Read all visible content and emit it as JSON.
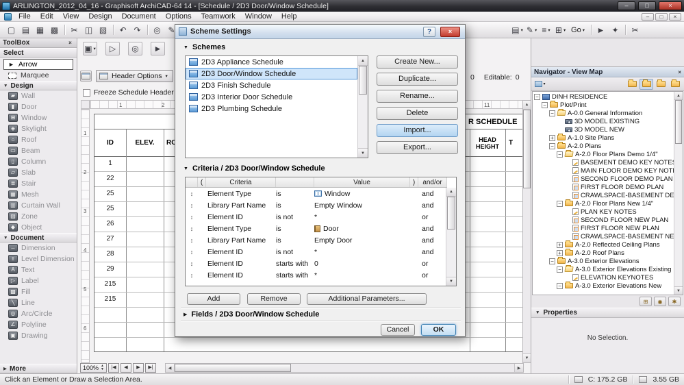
{
  "window": {
    "title": "ARLINGTON_2012_04_16 - Graphisoft ArchiCAD-64 14 - [Schedule / 2D3 Door/Window Schedule]"
  },
  "icons": {
    "minimize": "–",
    "maximize": "□",
    "close": "×",
    "help": "?",
    "dropdown": "▾",
    "tri_open": "▼",
    "tri_closed": "▶",
    "reorder": "↕",
    "up": "▲",
    "down": "▼",
    "left": "◀",
    "right": "▶"
  },
  "menu": {
    "items": [
      "File",
      "Edit",
      "View",
      "Design",
      "Document",
      "Options",
      "Teamwork",
      "Window",
      "Help"
    ]
  },
  "toolbar": {
    "left": [
      {
        "type": "icon",
        "name": "new-icon",
        "glyph": "▢",
        "inter": "true"
      },
      {
        "type": "icon",
        "name": "open-icon",
        "glyph": "▤",
        "inter": "true"
      },
      {
        "type": "icon",
        "name": "save-icon",
        "glyph": "▦",
        "inter": "true"
      },
      {
        "type": "icon",
        "name": "print-icon",
        "glyph": "▩",
        "inter": "true"
      },
      {
        "type": "sep",
        "name": "separator",
        "glyph": "",
        "inter": "false"
      },
      {
        "type": "icon",
        "name": "cut-icon",
        "glyph": "✂",
        "inter": "true"
      },
      {
        "type": "icon",
        "name": "copy-icon",
        "glyph": "◫",
        "inter": "true"
      },
      {
        "type": "icon",
        "name": "paste-icon",
        "glyph": "▧",
        "inter": "true"
      },
      {
        "type": "sep",
        "name": "separator",
        "glyph": "",
        "inter": "false"
      },
      {
        "type": "icon",
        "name": "undo-icon",
        "glyph": "↶",
        "inter": "true"
      },
      {
        "type": "icon",
        "name": "redo-icon",
        "glyph": "↷",
        "inter": "true"
      },
      {
        "type": "sep",
        "name": "separator",
        "glyph": "",
        "inter": "false"
      },
      {
        "type": "icon",
        "name": "zoom-icon",
        "glyph": "◎",
        "inter": "true"
      },
      {
        "type": "icon",
        "name": "pen-icon",
        "glyph": "✎",
        "inter": "true"
      },
      {
        "type": "sep",
        "name": "separator",
        "glyph": "",
        "inter": "false"
      },
      {
        "type": "icon",
        "name": "options-icon",
        "glyph": "≡",
        "inter": "true"
      }
    ],
    "right": [
      {
        "type": "dd",
        "name": "layers-icon",
        "glyph": "▤",
        "inter": "true"
      },
      {
        "type": "dd",
        "name": "pen-set-icon",
        "glyph": "✎",
        "inter": "true"
      },
      {
        "type": "dd",
        "name": "line-type-icon",
        "glyph": "≡",
        "inter": "true"
      },
      {
        "type": "dd",
        "name": "display-options-icon",
        "glyph": "⊞",
        "inter": "true"
      },
      {
        "type": "ddtext",
        "name": "go-menu",
        "glyph": "Go",
        "inter": "true"
      },
      {
        "type": "sep",
        "name": "separator",
        "glyph": "",
        "inter": "false"
      },
      {
        "type": "icon",
        "name": "arrow-tool-icon",
        "glyph": "►",
        "inter": "true"
      },
      {
        "type": "icon",
        "name": "walk-tool-icon",
        "glyph": "✦",
        "inter": "true"
      },
      {
        "type": "sep",
        "name": "separator",
        "glyph": "",
        "inter": "false"
      },
      {
        "type": "icon",
        "name": "section-tool-icon",
        "glyph": "✂",
        "inter": "true"
      }
    ]
  },
  "toolbox": {
    "title": "ToolBox",
    "select_label": "Select",
    "arrow": {
      "label": "Arrow",
      "glyph": "►"
    },
    "marquee": {
      "label": "Marquee"
    },
    "design": {
      "label": "Design",
      "items": [
        {
          "label": "Wall",
          "icon": "wall-icon",
          "glyph": "▰"
        },
        {
          "label": "Door",
          "icon": "door-icon",
          "glyph": "▮"
        },
        {
          "label": "Window",
          "icon": "window-icon",
          "glyph": "⊞"
        },
        {
          "label": "Skylight",
          "icon": "skylight-icon",
          "glyph": "◈"
        },
        {
          "label": "Roof",
          "icon": "roof-icon",
          "glyph": "⌂"
        },
        {
          "label": "Beam",
          "icon": "beam-icon",
          "glyph": "▭"
        },
        {
          "label": "Column",
          "icon": "column-icon",
          "glyph": "▯"
        },
        {
          "label": "Slab",
          "icon": "slab-icon",
          "glyph": "▱"
        },
        {
          "label": "Stair",
          "icon": "stair-icon",
          "glyph": "≣"
        },
        {
          "label": "Mesh",
          "icon": "mesh-icon",
          "glyph": "▦"
        },
        {
          "label": "Curtain Wall",
          "icon": "curtain-wall-icon",
          "glyph": "▥"
        },
        {
          "label": "Zone",
          "icon": "zone-icon",
          "glyph": "▨"
        },
        {
          "label": "Object",
          "icon": "object-icon",
          "glyph": "◆"
        }
      ]
    },
    "document": {
      "label": "Document",
      "items": [
        {
          "label": "Dimension",
          "icon": "dimension-icon",
          "glyph": "↔"
        },
        {
          "label": "Level Dimension",
          "icon": "level-dimension-icon",
          "glyph": "±"
        },
        {
          "label": "Text",
          "icon": "text-icon",
          "glyph": "A"
        },
        {
          "label": "Label",
          "icon": "label-icon",
          "glyph": "▷"
        },
        {
          "label": "Fill",
          "icon": "fill-icon",
          "glyph": "▩"
        },
        {
          "label": "Line",
          "icon": "line-icon",
          "glyph": "╲"
        },
        {
          "label": "Arc/Circle",
          "icon": "arc-circle-icon",
          "glyph": "◎"
        },
        {
          "label": "Polyline",
          "icon": "polyline-icon",
          "glyph": "∠"
        },
        {
          "label": "Drawing",
          "icon": "drawing-icon",
          "glyph": "▣"
        }
      ]
    },
    "more_label": "More"
  },
  "schedule": {
    "tools": [
      {
        "type": "dd",
        "name": "pet-palette-icon",
        "glyph": "▣",
        "inter": "true"
      },
      {
        "type": "icon",
        "name": "tool-arrow-icon",
        "glyph": "▷",
        "inter": "true"
      },
      {
        "type": "icon",
        "name": "tool-circle-icon",
        "glyph": "◎",
        "inter": "true"
      },
      {
        "type": "icon",
        "name": "tool-cursor-icon",
        "glyph": "►",
        "inter": "true"
      }
    ],
    "header_options_label": "Header Options",
    "merge_icon_glyph": "⊟",
    "freeze_label": "Freeze Schedule Header",
    "freeze_checked": false,
    "count_value": "0",
    "editable_label": "Editable:",
    "editable_value": "0",
    "title_fragment": "R SCHEDULE",
    "columns": [
      "ID",
      "ELEV.",
      "RO"
    ],
    "right_columns": [
      "HEAD HEIGHT",
      "T"
    ],
    "rows": [
      "1",
      "22",
      "25",
      "25",
      "26",
      "27",
      "28",
      "29",
      "215",
      "215",
      "",
      "",
      ""
    ],
    "zoom": "100%",
    "nav_buttons": [
      "|◀",
      "◀",
      "▶",
      "▶|"
    ],
    "h_ruler": [
      {
        "label": "1",
        "style": "left:42px"
      },
      {
        "label": "2",
        "style": "left:104px"
      },
      {
        "label": "11",
        "style": "left:575px"
      }
    ],
    "v_ruler": [
      {
        "label": "1",
        "style": "top:30px"
      },
      {
        "label": "2",
        "style": "top:87px"
      },
      {
        "label": "3",
        "style": "top:144px"
      },
      {
        "label": "4",
        "style": "top:201px"
      },
      {
        "label": "5",
        "style": "top:258px"
      },
      {
        "label": "6",
        "style": "top:315px"
      }
    ]
  },
  "dialog": {
    "title": "Scheme Settings",
    "schemes_label": "Schemes",
    "schemes": [
      {
        "label": "2D3 Appliance Schedule",
        "selected": false
      },
      {
        "label": "2D3 Door/Window Schedule",
        "selected": true
      },
      {
        "label": "2D3 Finish Schedule",
        "selected": false
      },
      {
        "label": "2D3 Interior Door Schedule",
        "selected": false
      },
      {
        "label": "2D3 Plumbing Schedule",
        "selected": false
      }
    ],
    "buttons": [
      {
        "label": "Create New...",
        "name": "create-new-button",
        "highlight": false
      },
      {
        "label": "Duplicate...",
        "name": "duplicate-button",
        "highlight": false
      },
      {
        "label": "Rename...",
        "name": "rename-button",
        "highlight": false
      },
      {
        "label": "Delete",
        "name": "delete-button",
        "highlight": false
      },
      {
        "label": "Import...",
        "name": "import-button",
        "highlight": true
      },
      {
        "label": "Export...",
        "name": "export-button",
        "highlight": false
      }
    ],
    "criteria_label": "Criteria / 2D3 Door/Window Schedule",
    "criteria_headers": {
      "open_paren": "(",
      "criteria": "Criteria",
      "op": "",
      "value": "Value",
      "close_paren": ")",
      "andor": "and/or"
    },
    "criteria_rows": [
      {
        "criteria": "Element Type",
        "op": "is",
        "value": "Window",
        "icon": "window",
        "icon_name": "window-icon",
        "andor": "and"
      },
      {
        "criteria": "Library Part Name",
        "op": "is",
        "value": "Empty Window",
        "icon": "none",
        "icon_name": "no-icon",
        "andor": "and"
      },
      {
        "criteria": "Element ID",
        "op": "is not",
        "value": "*",
        "icon": "none",
        "icon_name": "no-icon",
        "andor": "or"
      },
      {
        "criteria": "Element Type",
        "op": "is",
        "value": "Door",
        "icon": "door",
        "icon_name": "door-icon",
        "andor": "and"
      },
      {
        "criteria": "Library Part Name",
        "op": "is",
        "value": "Empty Door",
        "icon": "none",
        "icon_name": "no-icon",
        "andor": "and"
      },
      {
        "criteria": "Element ID",
        "op": "is not",
        "value": "*",
        "icon": "none",
        "icon_name": "no-icon",
        "andor": "and"
      },
      {
        "criteria": "Element ID",
        "op": "starts with",
        "value": "0",
        "icon": "none",
        "icon_name": "no-icon",
        "andor": "or"
      },
      {
        "criteria": "Element ID",
        "op": "starts with",
        "value": "*",
        "icon": "none",
        "icon_name": "no-icon",
        "andor": "or"
      }
    ],
    "add_label": "Add",
    "remove_label": "Remove",
    "additional_label": "Additional Parameters...",
    "fields_label": "Fields / 2D3 Door/Window Schedule",
    "cancel_label": "Cancel",
    "ok_label": "OK"
  },
  "navigator": {
    "title": "Navigator - View Map",
    "right_icons": [
      {
        "name": "project-map-icon",
        "active": false
      },
      {
        "name": "view-map-icon",
        "active": true
      },
      {
        "name": "layout-book-icon",
        "active": false
      },
      {
        "name": "publisher-sets-icon",
        "active": false
      }
    ],
    "bottom_icons": [
      {
        "name": "new-folder-icon",
        "glyph": "⊞"
      },
      {
        "name": "save-view-icon",
        "glyph": "◉"
      },
      {
        "name": "settings-icon",
        "glyph": "✱"
      }
    ],
    "tree": [
      {
        "label": "DINH RESIDENCE",
        "depth": 0,
        "icon": "project",
        "icon_name": "project-icon",
        "expand": "minus"
      },
      {
        "label": "Plot/Print",
        "depth": 1,
        "icon": "folder",
        "icon_name": "folder-icon",
        "expand": "minus"
      },
      {
        "label": "A-0.0 General Information",
        "depth": 2,
        "icon": "folder-open",
        "icon_name": "open-folder-icon",
        "expand": "minus"
      },
      {
        "label": "3D MODEL EXISTING",
        "depth": 3,
        "icon": "camera",
        "icon_name": "camera-icon",
        "expand": "none"
      },
      {
        "label": "3D MODEL NEW",
        "depth": 3,
        "icon": "camera",
        "icon_name": "camera-icon",
        "expand": "none"
      },
      {
        "label": "A-1.0 Site Plans",
        "depth": 2,
        "icon": "folder",
        "icon_name": "folder-icon",
        "expand": "plus"
      },
      {
        "label": "A-2.0 Plans",
        "depth": 2,
        "icon": "folder",
        "icon_name": "folder-icon",
        "expand": "minus"
      },
      {
        "label": "A-2.0 Floor Plans Demo 1/4\"",
        "depth": 3,
        "icon": "folder-open",
        "icon_name": "open-folder-icon",
        "expand": "minus"
      },
      {
        "label": "BASEMENT DEMO KEY NOTES",
        "depth": 4,
        "icon": "note",
        "icon_name": "keynote-icon",
        "expand": "none"
      },
      {
        "label": "MAIN FLOOR DEMO KEY NOTES",
        "depth": 4,
        "icon": "note",
        "icon_name": "keynote-icon",
        "expand": "none"
      },
      {
        "label": "SECOND FLOOR DEMO PLAN",
        "depth": 4,
        "icon": "plan",
        "icon_name": "plan-icon",
        "expand": "none"
      },
      {
        "label": "FIRST FLOOR DEMO PLAN",
        "depth": 4,
        "icon": "plan",
        "icon_name": "plan-icon",
        "expand": "none"
      },
      {
        "label": "CRAWLSPACE-BASEMENT DEMO P...",
        "depth": 4,
        "icon": "plan",
        "icon_name": "plan-icon",
        "expand": "none"
      },
      {
        "label": "A-2.0 Floor Plans New 1/4\"",
        "depth": 3,
        "icon": "folder",
        "icon_name": "folder-icon",
        "expand": "minus"
      },
      {
        "label": "PLAN KEY NOTES",
        "depth": 4,
        "icon": "note",
        "icon_name": "keynote-icon",
        "expand": "none"
      },
      {
        "label": "SECOND FLOOR NEW PLAN",
        "depth": 4,
        "icon": "plan",
        "icon_name": "plan-icon",
        "expand": "none"
      },
      {
        "label": "FIRST FLOOR NEW PLAN",
        "depth": 4,
        "icon": "plan",
        "icon_name": "plan-icon",
        "expand": "none"
      },
      {
        "label": "CRAWLSPACE-BASEMENT NEW PL...",
        "depth": 4,
        "icon": "plan",
        "icon_name": "plan-icon",
        "expand": "none"
      },
      {
        "label": "A-2.0 Reflected Ceiling Plans",
        "depth": 3,
        "icon": "folder",
        "icon_name": "folder-icon",
        "expand": "plus"
      },
      {
        "label": "A-2.0 Roof Plans",
        "depth": 3,
        "icon": "folder",
        "icon_name": "folder-icon",
        "expand": "plus"
      },
      {
        "label": "A-3.0 Exterior Elevations",
        "depth": 2,
        "icon": "folder",
        "icon_name": "folder-icon",
        "expand": "minus"
      },
      {
        "label": "A-3.0 Exterior Elevations Existing",
        "depth": 3,
        "icon": "folder-open",
        "icon_name": "open-folder-icon",
        "expand": "minus"
      },
      {
        "label": "ELEVATION KEYNOTES",
        "depth": 4,
        "icon": "note",
        "icon_name": "keynote-icon",
        "expand": "none"
      },
      {
        "label": "A-3.0 Exterior Elevations New",
        "depth": 3,
        "icon": "folder",
        "icon_name": "folder-icon",
        "expand": "minus"
      }
    ],
    "properties_label": "Properties",
    "no_selection": "No Selection."
  },
  "statusbar": {
    "hint": "Click an Element or Draw a Selection Area.",
    "disk": "C: 175.2 GB",
    "memory": "3.55 GB"
  }
}
